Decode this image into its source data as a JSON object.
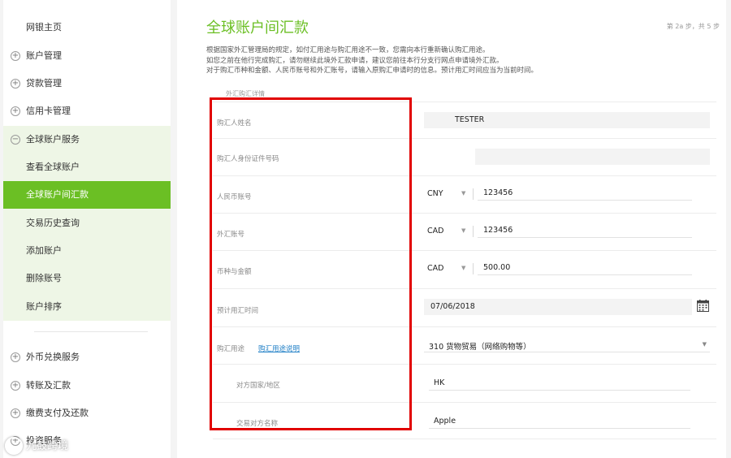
{
  "sidebar": {
    "items": [
      {
        "label": "网银主页",
        "expandable": false
      },
      {
        "label": "账户管理",
        "expandable": true
      },
      {
        "label": "贷款管理",
        "expandable": true
      },
      {
        "label": "信用卡管理",
        "expandable": true
      },
      {
        "label": "全球账户服务",
        "expandable": true,
        "expanded": true
      },
      {
        "label": "查看全球账户",
        "sub": true
      },
      {
        "label": "全球账户间汇款",
        "sub": true,
        "active": true
      },
      {
        "label": "交易历史查询",
        "sub": true
      },
      {
        "label": "添加账户",
        "sub": true
      },
      {
        "label": "删除账号",
        "sub": true
      },
      {
        "label": "账户排序",
        "sub": true
      },
      {
        "label": "外币兑换服务",
        "expandable": true
      },
      {
        "label": "转账及汇款",
        "expandable": true
      },
      {
        "label": "缴费支付及还款",
        "expandable": true
      },
      {
        "label": "投资服务",
        "expandable": true
      }
    ]
  },
  "main": {
    "title": "全球账户间汇款",
    "step": "第 2a 步，共 5 步",
    "description": [
      "根据国家外汇管理局的规定，如付汇用途与购汇用途不一致，您需向本行重新确认购汇用途。",
      "如您之前在他行完成购汇，请勿继续此境外汇款申请，建议您前往本行分支行网点申请境外汇款。",
      "对于购汇币种和金额、人民币账号和外汇账号，请输入原购汇申请时的信息。预计用汇时间应当为当前时间。"
    ],
    "section_header": "外汇购汇详情",
    "form": {
      "buyer_name": {
        "label": "购汇人姓名",
        "value": "TESTER"
      },
      "buyer_id": {
        "label": "购汇人身份证件号码",
        "value": ""
      },
      "rmb_account": {
        "label": "人民币账号",
        "currency": "CNY",
        "value": "123456"
      },
      "fx_account": {
        "label": "外汇账号",
        "currency": "CAD",
        "value": "123456"
      },
      "currency_amount": {
        "label": "币种与金额",
        "currency": "CAD",
        "value": "500.00"
      },
      "expected_date": {
        "label": "预计用汇时间",
        "value": "07/06/2018"
      },
      "purpose": {
        "label": "购汇用途",
        "link": "购汇用途说明",
        "value": "310 货物贸易（网络购物等）"
      },
      "counterparty_region": {
        "label": "对方国家/地区",
        "value": "HK"
      },
      "counterparty_name": {
        "label": "交易对方名称",
        "value": "Apple"
      }
    }
  },
  "watermark": "九鼓跨境",
  "colors": {
    "brand_green": "#6bbf24",
    "highlight_red": "#e10000",
    "link_blue": "#1f7fc6"
  }
}
